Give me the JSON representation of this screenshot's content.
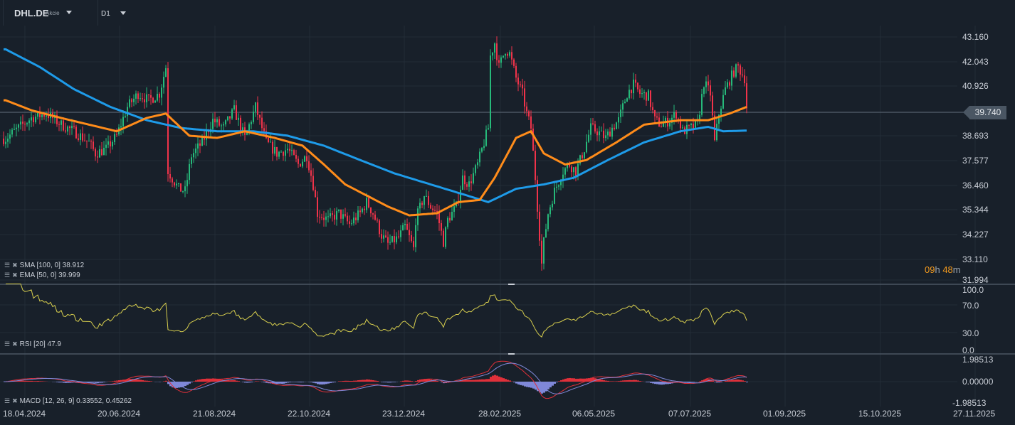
{
  "header": {
    "symbol": "DHL.DE",
    "instrument_type": "Akcie",
    "timeframe": "D1"
  },
  "colors": {
    "background": "#18202a",
    "up": "#26b97a",
    "down": "#f0334a",
    "sma": "#1e9be9",
    "ema": "#ff8c1a",
    "rsi": "#d8cf4e",
    "macd": "#e0303a",
    "signal": "#7f88d8"
  },
  "indicators": {
    "sma_label": "SMA [100,  0] 38.912",
    "ema_label": "EMA [50,  0] 39.999",
    "rsi_label": "RSI [20]  47.9",
    "macd_label": "MACD [12,  26,  9] 0.33552,  0.45262"
  },
  "timer": {
    "hours": "09",
    "h": "h",
    "minutes": "48",
    "m": "m"
  },
  "chart_data": {
    "type": "candlestick",
    "title": "DHL.DE D1",
    "current_price": "39.740",
    "price_axis_ticks": [
      "43.160",
      "42.043",
      "40.926",
      "39.740",
      "38.693",
      "37.577",
      "36.460",
      "35.344",
      "34.227",
      "33.110",
      "31.994"
    ],
    "price_range": [
      31.994,
      43.16
    ],
    "rsi_axis_ticks": [
      "100.0",
      "70.0",
      "30.0",
      "0.0"
    ],
    "macd_axis_ticks": [
      "1.98513",
      "0.00000",
      "-1.98513"
    ],
    "macd_range": [
      -1.98513,
      1.98513
    ],
    "x_tick_labels": [
      "18.04.2024",
      "20.06.2024",
      "21.08.2024",
      "22.10.2024",
      "23.12.2024",
      "28.02.2025",
      "06.05.2025",
      "07.07.2025",
      "01.09.2025",
      "15.10.2025",
      "27.11.2025"
    ],
    "x_unit": "trading-day index from 18.04.2024",
    "close_keypoints": [
      [
        1,
        38.57
      ],
      [
        7,
        39.05
      ],
      [
        13,
        39.5
      ],
      [
        20,
        39.7
      ],
      [
        27,
        39.2
      ],
      [
        33,
        38.9
      ],
      [
        40,
        38.4
      ],
      [
        43,
        37.9
      ],
      [
        48,
        38.1
      ],
      [
        53,
        38.7
      ],
      [
        58,
        40.0
      ],
      [
        63,
        40.6
      ],
      [
        68,
        40.3
      ],
      [
        73,
        40.6
      ],
      [
        76,
        41.8
      ],
      [
        77,
        37.1
      ],
      [
        82,
        36.3
      ],
      [
        85,
        36.2
      ],
      [
        88,
        37.8
      ],
      [
        93,
        38.4
      ],
      [
        98,
        39.4
      ],
      [
        103,
        39.05
      ],
      [
        108,
        39.85
      ],
      [
        113,
        38.6
      ],
      [
        118,
        40.0
      ],
      [
        123,
        38.4
      ],
      [
        128,
        37.9
      ],
      [
        133,
        38.1
      ],
      [
        138,
        37.4
      ],
      [
        142,
        37.8
      ],
      [
        145,
        36.5
      ],
      [
        147,
        35.2
      ],
      [
        152,
        34.9
      ],
      [
        157,
        35.2
      ],
      [
        162,
        34.7
      ],
      [
        167,
        35.2
      ],
      [
        170,
        35.7
      ],
      [
        173,
        35.2
      ],
      [
        177,
        34.2
      ],
      [
        180,
        33.8
      ],
      [
        185,
        34.1
      ],
      [
        188,
        34.6
      ],
      [
        192,
        33.6
      ],
      [
        193,
        34.9
      ],
      [
        197,
        36.0
      ],
      [
        200,
        35.5
      ],
      [
        203,
        35.2
      ],
      [
        206,
        33.9
      ],
      [
        208,
        34.9
      ],
      [
        212,
        35.5
      ],
      [
        215,
        36.8
      ],
      [
        218,
        36.5
      ],
      [
        222,
        37.4
      ],
      [
        225,
        38.4
      ],
      [
        227,
        39.05
      ],
      [
        228,
        42.3
      ],
      [
        230,
        42.9
      ],
      [
        232,
        41.8
      ],
      [
        235,
        42.6
      ],
      [
        237,
        42.4
      ],
      [
        240,
        41.3
      ],
      [
        243,
        40.6
      ],
      [
        245,
        39.7
      ],
      [
        247,
        39.05
      ],
      [
        249,
        36.8
      ],
      [
        251,
        34.2
      ],
      [
        252,
        32.9
      ],
      [
        253,
        33.9
      ],
      [
        255,
        35.2
      ],
      [
        258,
        36.2
      ],
      [
        262,
        37.1
      ],
      [
        265,
        37.4
      ],
      [
        268,
        37.1
      ],
      [
        272,
        38.1
      ],
      [
        275,
        39.05
      ],
      [
        278,
        38.9
      ],
      [
        282,
        38.6
      ],
      [
        285,
        39.05
      ],
      [
        288,
        39.4
      ],
      [
        292,
        40.6
      ],
      [
        295,
        41.0
      ],
      [
        298,
        40.6
      ],
      [
        302,
        40.5
      ],
      [
        305,
        39.4
      ],
      [
        308,
        39.2
      ],
      [
        312,
        39.4
      ],
      [
        315,
        39.7
      ],
      [
        318,
        38.9
      ],
      [
        322,
        39.05
      ],
      [
        325,
        39.2
      ],
      [
        328,
        41.1
      ],
      [
        331,
        40.6
      ],
      [
        333,
        38.4
      ],
      [
        335,
        39.7
      ],
      [
        338,
        40.8
      ],
      [
        342,
        41.6
      ],
      [
        344,
        41.8
      ],
      [
        347,
        41.3
      ],
      [
        348,
        40.0
      ]
    ],
    "sma_keypoints": [
      [
        1,
        42.6
      ],
      [
        17,
        41.8
      ],
      [
        33,
        40.8
      ],
      [
        50,
        40.0
      ],
      [
        67,
        39.4
      ],
      [
        83,
        39.05
      ],
      [
        100,
        38.9
      ],
      [
        117,
        38.9
      ],
      [
        133,
        38.7
      ],
      [
        150,
        38.25
      ],
      [
        167,
        37.6
      ],
      [
        183,
        37.0
      ],
      [
        200,
        36.5
      ],
      [
        217,
        36.0
      ],
      [
        227,
        35.7
      ],
      [
        240,
        36.3
      ],
      [
        253,
        36.5
      ],
      [
        267,
        36.8
      ],
      [
        283,
        37.6
      ],
      [
        300,
        38.4
      ],
      [
        317,
        38.9
      ],
      [
        330,
        39.1
      ],
      [
        337,
        38.9
      ],
      [
        348,
        38.93
      ]
    ],
    "ema_keypoints": [
      [
        1,
        40.3
      ],
      [
        13,
        39.85
      ],
      [
        27,
        39.5
      ],
      [
        40,
        39.2
      ],
      [
        53,
        38.9
      ],
      [
        67,
        39.5
      ],
      [
        76,
        39.7
      ],
      [
        87,
        38.7
      ],
      [
        100,
        38.6
      ],
      [
        113,
        38.9
      ],
      [
        127,
        38.6
      ],
      [
        140,
        38.25
      ],
      [
        150,
        37.4
      ],
      [
        160,
        36.5
      ],
      [
        170,
        36.0
      ],
      [
        180,
        35.5
      ],
      [
        190,
        35.1
      ],
      [
        203,
        35.2
      ],
      [
        213,
        35.7
      ],
      [
        223,
        35.8
      ],
      [
        230,
        36.8
      ],
      [
        240,
        38.6
      ],
      [
        247,
        38.9
      ],
      [
        253,
        37.9
      ],
      [
        263,
        37.4
      ],
      [
        273,
        37.6
      ],
      [
        287,
        38.4
      ],
      [
        300,
        39.2
      ],
      [
        317,
        39.4
      ],
      [
        330,
        39.4
      ],
      [
        340,
        39.7
      ],
      [
        348,
        40.0
      ]
    ]
  }
}
